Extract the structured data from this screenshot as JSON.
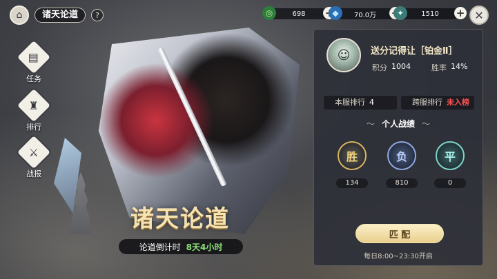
{
  "header": {
    "title": "诸天论道",
    "help_icon": "?"
  },
  "currencies": [
    {
      "icon": "jade-coin-icon",
      "value": "698"
    },
    {
      "icon": "crystal-icon",
      "value": "70.0万"
    },
    {
      "icon": "sword-icon",
      "value": "1510"
    }
  ],
  "nav": [
    {
      "label": "任务",
      "icon": "book-icon"
    },
    {
      "label": "排行",
      "icon": "rank-icon"
    },
    {
      "label": "战报",
      "icon": "battle-report-icon"
    }
  ],
  "event": {
    "title": "诸天论道",
    "countdown_label": "论道倒计时",
    "countdown_value": "8天4小时"
  },
  "player": {
    "name": "送分记得让［铂金Ⅱ］",
    "score_label": "积分",
    "score": "1004",
    "winrate_label": "胜率",
    "winrate": "14%"
  },
  "ranks": {
    "server_label": "本服排行",
    "server_value": "4",
    "cross_label": "跨服排行",
    "cross_value": "未入榜"
  },
  "record": {
    "title": "个人战绩",
    "win_glyph": "胜",
    "win": "134",
    "lose_glyph": "负",
    "lose": "810",
    "draw_glyph": "平",
    "draw": "0"
  },
  "match": {
    "button_label": "匹 配",
    "schedule": "每日8:00~23:30开启"
  }
}
